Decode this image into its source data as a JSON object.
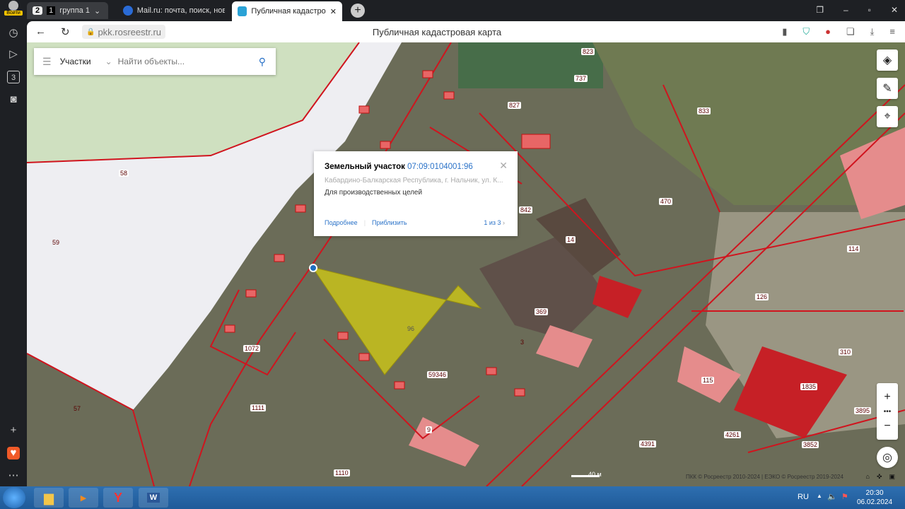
{
  "browser": {
    "login_label": "Войти",
    "tab_count": "2",
    "group_count": "1",
    "group_label": "группа 1",
    "tabs": [
      {
        "label": "Mail.ru: почта, поиск, нов"
      },
      {
        "label": "Публичная кадастрова"
      }
    ],
    "url": "pkk.rosreestr.ru",
    "page_title": "Публичная кадастровая карта",
    "sidebar_badge": "3"
  },
  "search": {
    "mode": "Участки",
    "placeholder": "Найти объекты..."
  },
  "popup": {
    "type": "Земельный участок",
    "cadastral_number": "07:09:0104001:96",
    "address": "Кабардино-Балкарская Республика, г. Нальчик, ул. К...",
    "purpose": "Для производственных целей",
    "details_link": "Подробнее",
    "zoom_link": "Приблизить",
    "pager": "1 из 3"
  },
  "map": {
    "parcel_labels": [
      "58",
      "59",
      "57",
      "737",
      "823",
      "827",
      "833",
      "842",
      "470",
      "114",
      "14",
      "126",
      "369",
      "310",
      "1835",
      "96",
      "1072",
      "1111",
      "1110",
      "59346",
      "4391",
      "3852",
      "3895",
      "4261",
      "115",
      "9",
      "3"
    ],
    "scale": "40 м",
    "attribution": "ПКК © Росреестр 2010-2024 | ЕЭКО © Росреестр 2019-2024",
    "selected_color": "#c8c21a",
    "boundary_color": "#d0141e"
  },
  "taskbar": {
    "lang": "RU",
    "time": "20:30",
    "date": "06.02.2024"
  }
}
